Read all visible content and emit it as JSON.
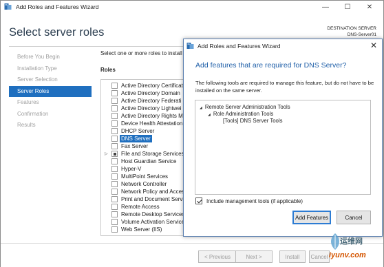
{
  "window": {
    "title": "Add Roles and Features Wizard",
    "controls": {
      "minimize": "—",
      "maximize": "☐",
      "close": "✕"
    }
  },
  "page": {
    "title": "Select server roles",
    "destination_label": "DESTINATION SERVER",
    "destination_server": "DNS-Server01"
  },
  "nav": {
    "items": [
      {
        "label": "Before You Begin",
        "active": false
      },
      {
        "label": "Installation Type",
        "active": false
      },
      {
        "label": "Server Selection",
        "active": false
      },
      {
        "label": "Server Roles",
        "active": true
      },
      {
        "label": "Features",
        "active": false
      },
      {
        "label": "Confirmation",
        "active": false
      },
      {
        "label": "Results",
        "active": false
      }
    ]
  },
  "content": {
    "instruction": "Select one or more roles to install",
    "roles_header": "Roles",
    "roles": [
      {
        "label": "Active Directory Certificat"
      },
      {
        "label": "Active Directory Domain"
      },
      {
        "label": "Active Directory Federati"
      },
      {
        "label": "Active Directory Lightwei"
      },
      {
        "label": "Active Directory Rights M"
      },
      {
        "label": "Device Health Attestation"
      },
      {
        "label": "DHCP Server"
      },
      {
        "label": "DNS Server"
      },
      {
        "label": "Fax Server"
      },
      {
        "label": "File and Storage Services"
      },
      {
        "label": "Host Guardian Service"
      },
      {
        "label": "Hyper-V"
      },
      {
        "label": "MultiPoint Services"
      },
      {
        "label": "Network Controller"
      },
      {
        "label": "Network Policy and Acces"
      },
      {
        "label": "Print and Document Servi"
      },
      {
        "label": "Remote Access"
      },
      {
        "label": "Remote Desktop Services"
      },
      {
        "label": "Volume Activation Service"
      },
      {
        "label": "Web Server (IIS)"
      }
    ]
  },
  "wizard_buttons": {
    "previous": "< Previous",
    "next": "Next >",
    "install": "Install",
    "cancel": "Cancel"
  },
  "dialog": {
    "title": "Add Roles and Features Wizard",
    "heading": "Add features that are required for DNS Server?",
    "description": "The following tools are required to manage this feature, but do not have to be installed on the same server.",
    "tree": [
      {
        "label": "Remote Server Administration Tools"
      },
      {
        "label": "Role Administration Tools"
      },
      {
        "label": "[Tools] DNS Server Tools"
      }
    ],
    "include_mgmt_label": "Include management tools (if applicable)",
    "include_mgmt_checked": true,
    "add_features": "Add Features",
    "cancel": "Cancel"
  },
  "watermark": {
    "line1": "运维网",
    "line2": "iyunv.com"
  },
  "colors": {
    "accent": "#1f6fbf",
    "heading": "#1f5fa8",
    "title": "#2c3e50"
  }
}
